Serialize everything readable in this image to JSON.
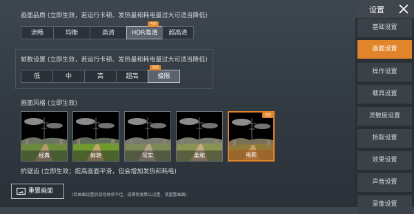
{
  "quality": {
    "title": "画面品质 (立即生效，若运行卡顿、发热量和耗电量过大可适当降低)",
    "options": [
      "流畅",
      "均衡",
      "高清",
      "HDR高清",
      "超高清"
    ],
    "selected": "HDR高清",
    "badge": "当前"
  },
  "fps": {
    "title": "帧数设置 (立即生效，若运行卡顿、发热量和耗电量过大可适当降低)",
    "options": [
      "低",
      "中",
      "高",
      "超高",
      "极限"
    ],
    "selected": "极限",
    "badge": "当前"
  },
  "style": {
    "title": "画面风格 (立即生效)",
    "options": [
      "经典",
      "鲜艳",
      "写实",
      "柔和",
      "电影"
    ],
    "selected": "电影",
    "badge": "当前"
  },
  "antialias": {
    "title": "抗锯齿 (立即生效；提高画面平滑，但会增加发热和耗电)"
  },
  "reset": {
    "label": "重置画面",
    "hint": "(若画面设置后游戏体验不佳，或需恢复默认设置，请重置画面)"
  },
  "sidebar": {
    "title": "设置",
    "items": [
      "基础设置",
      "画面设置",
      "操作设置",
      "载具设置",
      "灵敏度设置",
      "拾取设置",
      "效果设置",
      "声音设置",
      "录像设置"
    ],
    "active": "画面设置"
  },
  "colors": {
    "accent": "#e2842a",
    "sidebar_bg": "#2a2f35",
    "panel_bg": "#363d45"
  },
  "icons": {
    "close": "close-icon",
    "reset": "reset-screen-icon"
  }
}
